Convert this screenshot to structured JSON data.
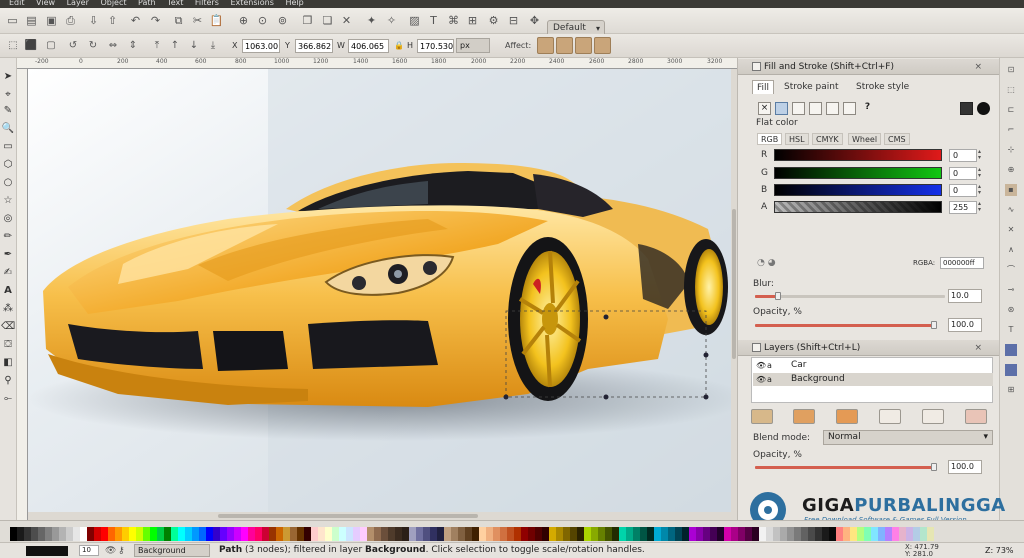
{
  "menubar": {
    "items": [
      "Edit",
      "View",
      "Layer",
      "Object",
      "Path",
      "Text",
      "Filters",
      "Extensions",
      "Help"
    ]
  },
  "command_bar": {
    "style_dropdown": "Default"
  },
  "control_bar": {
    "x_label": "X",
    "x_value": "1063.00",
    "y_label": "Y",
    "y_value": "366.862",
    "w_label": "W",
    "w_value": "406.065",
    "h_label": "H",
    "h_value": "170.530",
    "unit": "px",
    "affect_label": "Affect:"
  },
  "ruler": {
    "ticks": [
      "-200",
      "0",
      "200",
      "400",
      "600",
      "800",
      "1000",
      "1200",
      "1400",
      "1600",
      "1800",
      "2000",
      "2200",
      "2400",
      "2600",
      "2800",
      "3000",
      "3200"
    ]
  },
  "fill_stroke": {
    "title": "Fill and Stroke (Shift+Ctrl+F)",
    "tabs": [
      "Fill",
      "Stroke paint",
      "Stroke style"
    ],
    "active_tab": "Fill",
    "paint_buttons": [
      "×",
      "",
      "",
      "",
      "",
      "",
      "?"
    ],
    "flat_color_label": "Flat color",
    "color_modes": [
      "RGB",
      "HSL",
      "CMYK",
      "Wheel",
      "CMS"
    ],
    "active_mode": "RGB",
    "channels": [
      {
        "label": "R",
        "value": "0",
        "color": "#e01a1a"
      },
      {
        "label": "G",
        "value": "0",
        "color": "#12c712"
      },
      {
        "label": "B",
        "value": "0",
        "color": "#1530e8"
      },
      {
        "label": "A",
        "value": "255",
        "color": "#111111"
      }
    ],
    "rgba_label": "RGBA:",
    "rgba_value": "000000ff",
    "blur_label": "Blur:",
    "blur_value": "10.0",
    "opacity_label": "Opacity, %",
    "opacity_value": "100.0"
  },
  "layers": {
    "title": "Layers (Shift+Ctrl+L)",
    "rows": [
      {
        "name": "Car",
        "selected": false
      },
      {
        "name": "Background",
        "selected": true
      }
    ],
    "blend_label": "Blend mode:",
    "blend_value": "Normal",
    "opacity_label": "Opacity, %",
    "opacity_value": "100.0"
  },
  "status": {
    "stroke_width": "10",
    "layer_dropdown": "Background",
    "message_bold_1": "Path",
    "message_mid": " (3 nodes); filtered in layer ",
    "message_bold_2": "Background",
    "message_end": ". Click selection to toggle scale/rotation handles.",
    "x_coord": "X: 471.79",
    "y_coord": "Y: 281.0",
    "zoom_label": "Z:",
    "zoom_value": "73%"
  },
  "watermark": {
    "title_part1": "GIGA",
    "title_part2": "PURBALINGGA",
    "subtitle": "Free Download Software & Games Full Version"
  },
  "colors": {
    "car_body": "#f2b53a",
    "car_highlight": "#ffd98a",
    "canvas_bg": "#dfe5ea",
    "slider_red": "#d45f4f",
    "accent_blue": "#2d6f9f"
  }
}
